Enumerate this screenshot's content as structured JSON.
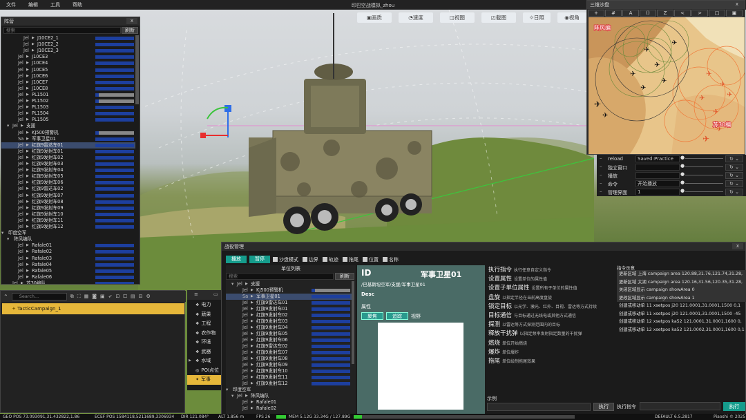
{
  "menubar": {
    "items": [
      "文件",
      "编辑",
      "工具",
      "帮助"
    ],
    "title": "印巴空战模拟_zhou"
  },
  "toolbar": {
    "buttons": [
      "画质",
      "速度",
      "视图",
      "截图",
      "日照",
      "视角"
    ]
  },
  "formation": {
    "title": "阵营",
    "close": "x",
    "search_placeholder": "搜索",
    "refresh": "刷新",
    "rows": [
      {
        "t": "Jel",
        "i": 3,
        "n": "J10CE2_1",
        "b": "blue"
      },
      {
        "t": "Jel",
        "i": 3,
        "n": "J10CE2_2",
        "b": "blue"
      },
      {
        "t": "Jel",
        "i": 3,
        "n": "J10CE2_3",
        "b": "blue"
      },
      {
        "t": "Jel",
        "i": 2,
        "n": "J10CE3",
        "b": "blue"
      },
      {
        "t": "Jel",
        "i": 2,
        "n": "J10CE4",
        "b": "blue"
      },
      {
        "t": "Jel",
        "i": 2,
        "n": "J10CE5",
        "b": "blue"
      },
      {
        "t": "Jel",
        "i": 2,
        "n": "J10CE6",
        "b": "blue"
      },
      {
        "t": "Jel",
        "i": 2,
        "n": "J10CE7",
        "b": "blue"
      },
      {
        "t": "Jel",
        "i": 2,
        "n": "J10CE8",
        "b": "blue"
      },
      {
        "t": "Jel",
        "i": 2,
        "n": "PL1501",
        "b": "gray"
      },
      {
        "t": "Jel",
        "i": 2,
        "n": "PL1502",
        "b": "gray"
      },
      {
        "t": "Jel",
        "i": 2,
        "n": "PL1503",
        "b": "blue"
      },
      {
        "t": "Jel",
        "i": 2,
        "n": "PL1504",
        "b": "blue"
      },
      {
        "t": "Jel",
        "i": 2,
        "n": "PL1505",
        "b": "blue"
      },
      {
        "t": "Jel",
        "i": 1,
        "n": "支援",
        "b": "none",
        "open": true
      },
      {
        "t": "Jel",
        "i": 2,
        "n": "KJ500预警机",
        "b": "gray"
      },
      {
        "t": "Sa",
        "i": 2,
        "n": "军事卫星01",
        "b": "blue"
      },
      {
        "t": "Jel",
        "i": 2,
        "n": "红旗9雷达车01",
        "b": "blue",
        "sel": true
      },
      {
        "t": "Jel",
        "i": 2,
        "n": "红旗9发射车01",
        "b": "blue"
      },
      {
        "t": "Jel",
        "i": 2,
        "n": "红旗9发射车02",
        "b": "blue"
      },
      {
        "t": "Jel",
        "i": 2,
        "n": "红旗9发射车03",
        "b": "blue"
      },
      {
        "t": "Jel",
        "i": 2,
        "n": "红旗9发射车04",
        "b": "blue"
      },
      {
        "t": "Jel",
        "i": 2,
        "n": "红旗9发射车05",
        "b": "blue"
      },
      {
        "t": "Jel",
        "i": 2,
        "n": "红旗9发射车06",
        "b": "blue"
      },
      {
        "t": "Jel",
        "i": 2,
        "n": "红旗9雷达车02",
        "b": "blue"
      },
      {
        "t": "Jel",
        "i": 2,
        "n": "红旗9发射车07",
        "b": "blue"
      },
      {
        "t": "Jel",
        "i": 2,
        "n": "红旗9发射车08",
        "b": "blue"
      },
      {
        "t": "Jel",
        "i": 2,
        "n": "红旗9发射车09",
        "b": "blue"
      },
      {
        "t": "Jel",
        "i": 2,
        "n": "红旗9发射车10",
        "b": "blue"
      },
      {
        "t": "Jel",
        "i": 2,
        "n": "红旗9发射车11",
        "b": "blue"
      },
      {
        "t": "Jel",
        "i": 2,
        "n": "红旗9发射车12",
        "b": "blue"
      },
      {
        "t": "",
        "i": 0,
        "n": "印度空军",
        "b": "none",
        "open": true
      },
      {
        "t": "",
        "i": 1,
        "n": "阵风编队",
        "b": "none",
        "open": true
      },
      {
        "t": "Jel",
        "i": 2,
        "n": "Rafale01",
        "b": "blue"
      },
      {
        "t": "Jel",
        "i": 2,
        "n": "Rafale02",
        "b": "blue"
      },
      {
        "t": "Jel",
        "i": 2,
        "n": "Rafale03",
        "b": "blue"
      },
      {
        "t": "Jel",
        "i": 2,
        "n": "Rafale04",
        "b": "blue"
      },
      {
        "t": "Jel",
        "i": 2,
        "n": "Rafale05",
        "b": "blue"
      },
      {
        "t": "Jel",
        "i": 2,
        "n": "Rafale06",
        "b": "blue"
      },
      {
        "t": "Jel",
        "i": 1,
        "n": "苏30编队",
        "b": "blue"
      }
    ]
  },
  "minimap": {
    "title": "三维沙盘",
    "close": "x",
    "tools": [
      "+",
      "#",
      "A",
      "()",
      "Z",
      "<",
      ">",
      "□",
      "▣"
    ],
    "labels": [
      "阵风编",
      "苏30编"
    ]
  },
  "props": {
    "rows": [
      {
        "k": "reload",
        "v": "Saved:Practice"
      },
      {
        "k": "独立窗口",
        "v": ""
      },
      {
        "k": "播放",
        "v": ""
      },
      {
        "k": "命令",
        "v": "开始播放"
      },
      {
        "k": "管理界面",
        "v": "1"
      }
    ]
  },
  "outliner": {
    "search_placeholder": "Search...",
    "campaign": "TacticCampaign_1"
  },
  "categories": {
    "items": [
      "电力",
      "蔬果",
      "工程",
      "农作物",
      "环境",
      "武器",
      "水域",
      "POI点位",
      "军事"
    ],
    "active": 8
  },
  "battle": {
    "title": "战役管理",
    "play": "播放",
    "pause": "暂停",
    "checks": [
      "沙盘模式",
      "边界",
      "轨迹",
      "拖尾",
      "位置",
      "名称"
    ],
    "unit_list_title": "单位列表",
    "search_placeholder": "搜索",
    "refresh": "刷新",
    "units": [
      {
        "t": "Jel",
        "i": 1,
        "n": "支援",
        "open": true
      },
      {
        "t": "Jel",
        "i": 2,
        "n": "KJ500预警机",
        "b": "gray"
      },
      {
        "t": "Sa",
        "i": 2,
        "n": "军事卫星01",
        "b": "blue",
        "sel": true
      },
      {
        "t": "Jel",
        "i": 2,
        "n": "红旗9雷达车01",
        "b": "blue"
      },
      {
        "t": "Jel",
        "i": 2,
        "n": "红旗9发射车01",
        "b": "blue"
      },
      {
        "t": "Jel",
        "i": 2,
        "n": "红旗9发射车02",
        "b": "blue"
      },
      {
        "t": "Jel",
        "i": 2,
        "n": "红旗9发射车03",
        "b": "blue"
      },
      {
        "t": "Jel",
        "i": 2,
        "n": "红旗9发射车04",
        "b": "blue"
      },
      {
        "t": "Jel",
        "i": 2,
        "n": "红旗9发射车05",
        "b": "blue"
      },
      {
        "t": "Jel",
        "i": 2,
        "n": "红旗9发射车06",
        "b": "blue"
      },
      {
        "t": "Jel",
        "i": 2,
        "n": "红旗9雷达车02",
        "b": "blue"
      },
      {
        "t": "Jel",
        "i": 2,
        "n": "红旗9发射车07",
        "b": "blue"
      },
      {
        "t": "Jel",
        "i": 2,
        "n": "红旗9发射车08",
        "b": "blue"
      },
      {
        "t": "Jel",
        "i": 2,
        "n": "红旗9发射车09",
        "b": "blue"
      },
      {
        "t": "Jel",
        "i": 2,
        "n": "红旗9发射车10",
        "b": "blue"
      },
      {
        "t": "Jel",
        "i": 2,
        "n": "红旗9发射车11",
        "b": "blue"
      },
      {
        "t": "Jel",
        "i": 2,
        "n": "红旗9发射车12",
        "b": "blue"
      },
      {
        "t": "",
        "i": 0,
        "n": "印度空军",
        "open": true
      },
      {
        "t": "Jel",
        "i": 1,
        "n": "阵风编队",
        "open": true
      },
      {
        "t": "Jel",
        "i": 2,
        "n": "Rafale01",
        "b": "none"
      },
      {
        "t": "Jel",
        "i": 2,
        "n": "Rafale02",
        "b": "none"
      }
    ],
    "detail": {
      "id_label": "ID",
      "name": "军事卫星01",
      "path": "/巴基斯坦空军/支援/军事卫星01",
      "desc": "Desc",
      "attr": "属性",
      "btn_focus": "聚焦",
      "btn_follow": "追踪",
      "btn_view": "视野"
    },
    "commands": [
      {
        "t": "执行指令",
        "d": "执行任意自定义指令"
      },
      {
        "t": "设置属性",
        "d": "设置单位的属性值"
      },
      {
        "t": "设置子单位属性",
        "d": "设置所有子单位的属性值"
      },
      {
        "t": "盘旋",
        "d": "以指定半径在当前高度盘旋"
      },
      {
        "t": "锁定目标",
        "d": "以光学、激光、红外、目视、雷达等方式持续"
      },
      {
        "t": "目标通信",
        "d": "与目标通过无线电或其他方式通信"
      },
      {
        "t": "探测",
        "d": "以雷达等方式探测范围内的目标"
      },
      {
        "t": "释放干扰弹",
        "d": "以指定频率发射指定数量的干扰弹"
      },
      {
        "t": "燃烧",
        "d": "单位开始燃烧"
      },
      {
        "t": "爆炸",
        "d": "单位爆炸"
      },
      {
        "t": "拖尾",
        "d": "单位绘制拖尾效果"
      }
    ],
    "example_label": "示例",
    "execute": "执行",
    "log_title": "指令示意",
    "log": [
      "更新区域 上海 campaign area 120.88,31.76,121.74,31.28,",
      "更新区域 太湖 campaign area 120.16,31.56,120.35,31.28,",
      "关闭区域显示 campaign showArea 0",
      "更改区域显示 campaign showArea 1",
      "创建或移动单 11 xsetpos j20 121.0001,31.0001,1500 0,1",
      "创建或移动单 11 xsetpos j20 121.0001,31.0001,1500 -45",
      "创建或移动单 12 xsetpos ka52 121.0001,31.0001,1600 0,",
      "创建或移动单 12 xsetpos ka52 121.0002,31.0001,1600 0,1"
    ],
    "exec_label": "执行指令",
    "exec_btn": "执行"
  },
  "statusbar": {
    "geo": "GEO POS 73.093091,31.432822,1.86",
    "ecef": "ECEF POS 1584118,5211689,3306934",
    "dir": "DIR 121.084°",
    "alt": "ALT 1.856 m",
    "fps": "FPS 26",
    "mem": "MEM 5.12G 33.34G / 127.89G",
    "default": "DEFAULT 6.5.2817",
    "piaoshi": "Piaoshi © 2025"
  }
}
